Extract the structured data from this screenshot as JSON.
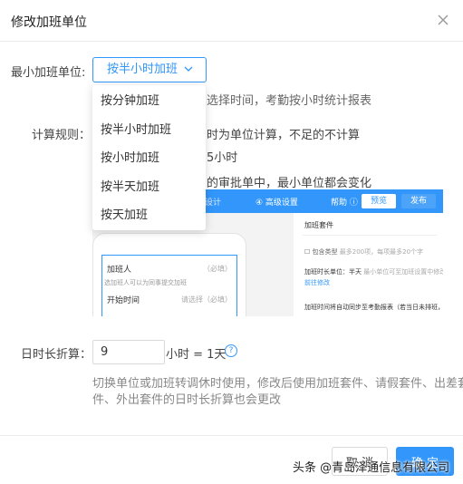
{
  "dialog": {
    "title": "修改加班单位"
  },
  "unit": {
    "label": "最小加班单位:",
    "selected": "按半小时加班",
    "options": [
      "按分钟加班",
      "按半小时加班",
      "按小时加班",
      "按半天加班",
      "按天加班"
    ],
    "hint": "选择时间，考勤按小时统计报表"
  },
  "rules": {
    "label": "计算规则：",
    "line1": "时为单位计算，不足的不计算",
    "line2": "5小时",
    "line3": "的审批单中，最小单位都会变化"
  },
  "preview": {
    "step_prev": "设计",
    "step": "④ 高级设置",
    "help": "帮助 ⓘ",
    "preview_btn": "预览",
    "publish_btn": "发布",
    "form_field1": "加班人",
    "form_field1_value": "（必填）",
    "form_note": "选加班人可以为同事提交加班",
    "form_field2": "开始时间",
    "form_field2_value": "请选择（必填）",
    "right_title": "加班套件",
    "right_opt": "包含类型",
    "right_opt_hint": "最多200项，每项最多20个字",
    "right_unit": "加班时长单位：半天",
    "right_unit_hint": "最小单位可至加班设置中修改，",
    "right_unit_link": "前往修改",
    "right_note": "加班时间将自动同步至考勤报表（若当日未排班，员工"
  },
  "conversion": {
    "label": "日时长折算：",
    "value": "9",
    "suffix": "小时 = 1天",
    "help": "?",
    "desc_line1": "切换单位或加班转调休时使用，修改后使用加班套件、请假套件、出差套",
    "desc_line2": "件、外出套件的日时长折算也会更改"
  },
  "footer": {
    "cancel": "取 消",
    "ok": "确 定"
  },
  "watermark": "头条 @青岛泽通信息有限公司",
  "colors": {
    "accent": "#3296fa",
    "text": "#333333",
    "muted": "#666666"
  }
}
